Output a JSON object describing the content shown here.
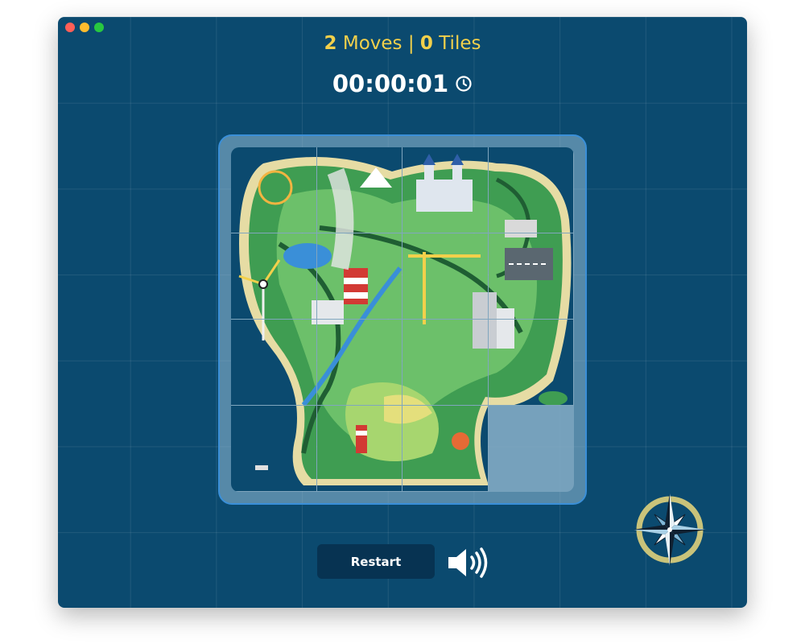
{
  "window": {
    "controls": [
      "close",
      "minimize",
      "maximize"
    ]
  },
  "stats": {
    "moves_count": "2",
    "moves_label": "Moves",
    "separator": "|",
    "tiles_count": "0",
    "tiles_label": "Tiles"
  },
  "timer": {
    "value": "00:00:01",
    "icon": "clock-icon"
  },
  "puzzle": {
    "grid_size": 4,
    "tile_count": 16,
    "empty_tile_position": [
      3,
      3
    ]
  },
  "controls": {
    "restart_label": "Restart",
    "sound_icon": "speaker-icon"
  },
  "decor": {
    "compass_icon": "compass-rose-icon"
  },
  "colors": {
    "background": "#0b4a6f",
    "accent": "#f2d04b",
    "button": "#073352",
    "board_border": "#3a8fd8"
  }
}
